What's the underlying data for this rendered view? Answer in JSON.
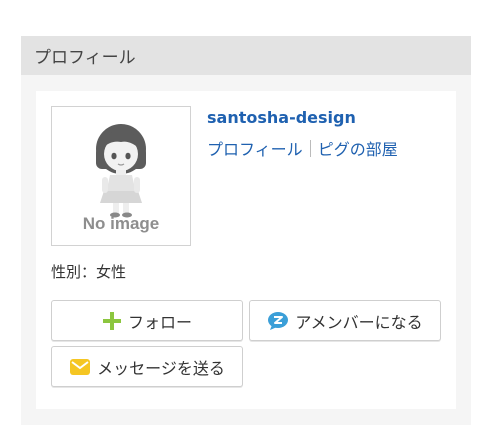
{
  "profile_widget": {
    "title": "プロフィール",
    "avatar": {
      "placeholder_text": "No image"
    },
    "username": "santosha-design",
    "links": {
      "profile": "プロフィール",
      "room": "ピグの部屋"
    },
    "gender_line": "性別：女性",
    "buttons": {
      "follow": "フォロー",
      "member": "アメンバーになる",
      "message": "メッセージを送る"
    },
    "icons": {
      "follow": "plus-icon",
      "member": "amember-bubble-icon",
      "message": "envelope-icon"
    },
    "colors": {
      "link": "#1f61b0",
      "plus": "#8cc63f",
      "amember": "#3b9fd8",
      "envelope": "#f5c623"
    }
  }
}
